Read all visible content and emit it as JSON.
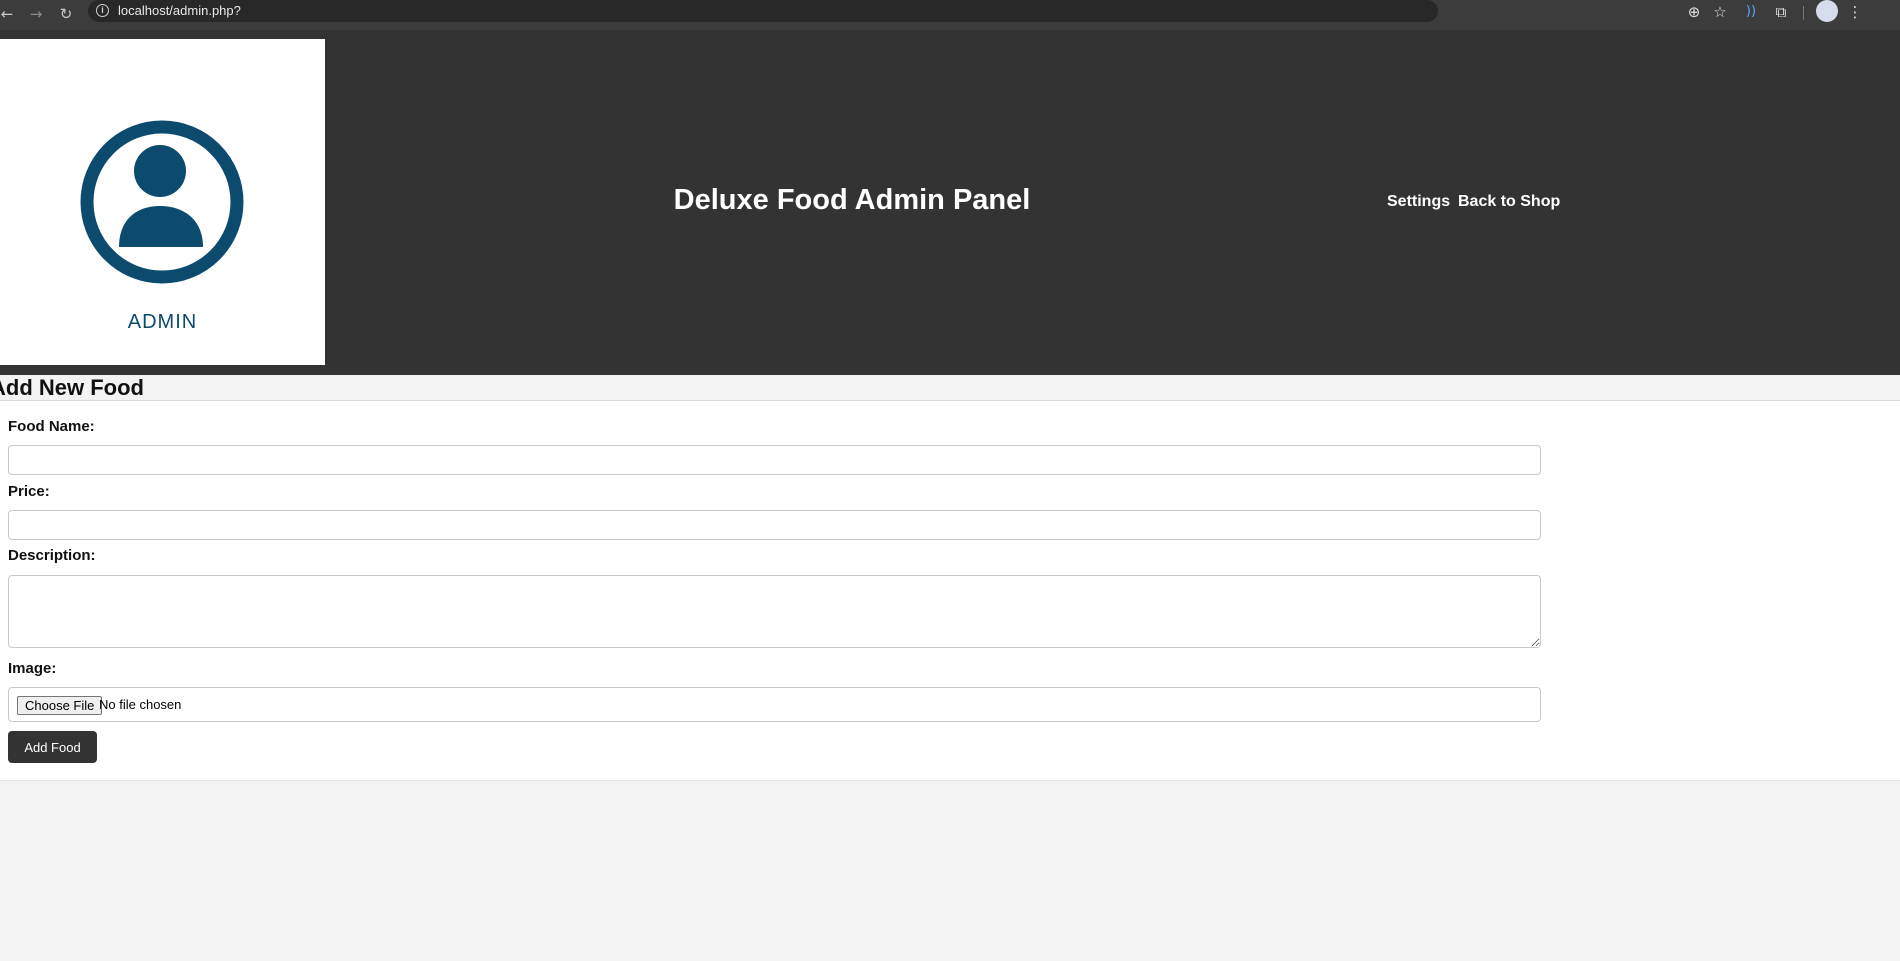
{
  "browser": {
    "url": "localhost/admin.php?",
    "icons": {
      "back": "arrow-left",
      "forward": "arrow-right",
      "reload": "reload",
      "site_info": "info",
      "zoom": "zoom",
      "bookmark": "star",
      "extension_active": "wifi-like",
      "extensions": "puzzle",
      "profile": "avatar",
      "menu": "kebab"
    }
  },
  "header": {
    "logo_text": "ADMIN",
    "title": "Deluxe Food Admin Panel",
    "nav": {
      "settings": "Settings",
      "back_to_shop": "Back to Shop"
    },
    "colors": {
      "background": "#333333",
      "logo_accent": "#0c4a6e"
    }
  },
  "section": {
    "title": "Add New Food"
  },
  "form": {
    "food_name_label": "Food Name:",
    "food_name_value": "",
    "price_label": "Price:",
    "price_value": "",
    "description_label": "Description:",
    "description_value": "",
    "image_label": "Image:",
    "choose_file_label": "Choose File",
    "file_status": "No file chosen",
    "submit_label": "Add Food"
  }
}
